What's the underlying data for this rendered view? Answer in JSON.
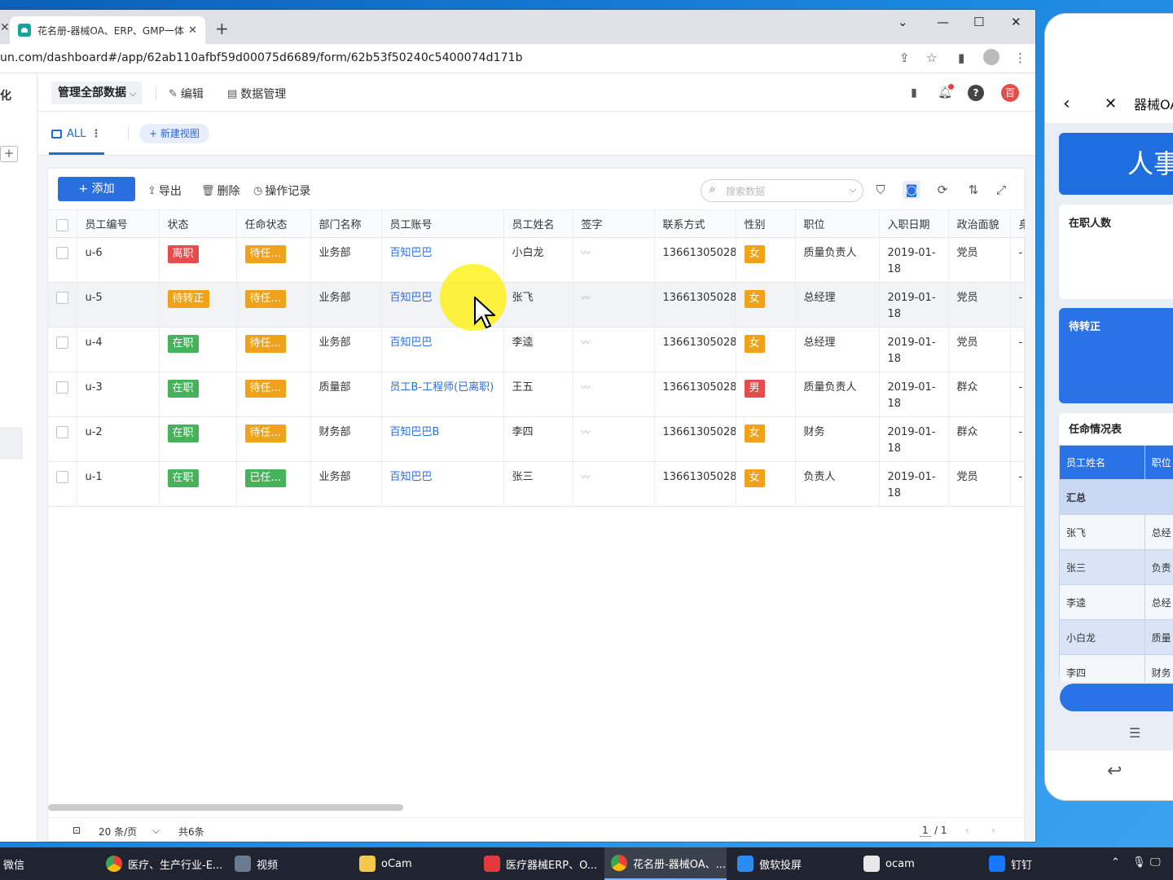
{
  "browser": {
    "tab_title": "花名册-器械OA、ERP、GMP一体化",
    "url": "un.com/dashboard#/app/62ab110afbf59d00075d6689/form/62b53f50240c5400074d171b"
  },
  "leftnav": {
    "brand": "化"
  },
  "topbar": {
    "scope": "管理全部数据",
    "edit": "编辑",
    "data_manage": "数据管理",
    "avatar": "百"
  },
  "viewbar": {
    "view_name": "ALL",
    "new_view": "新建视图"
  },
  "actions": {
    "add": "添加",
    "export": "导出",
    "delete": "删除",
    "history": "操作记录",
    "search_placeholder": "搜索数据"
  },
  "colors": {
    "green": "#46b35c",
    "orange": "#f0a21b",
    "red": "#e34d4d",
    "blue": "#2a6fe0"
  },
  "table": {
    "columns": [
      "员工编号",
      "状态",
      "任命状态",
      "部门名称",
      "员工账号",
      "员工姓名",
      "签字",
      "联系方式",
      "性别",
      "职位",
      "入职日期",
      "政治面貌",
      "身"
    ],
    "rows": [
      {
        "id": "u-6",
        "status": "离职",
        "status_color": "red",
        "appoint": "待任...",
        "appoint_color": "orange",
        "dept": "业务部",
        "account": "百知巴巴",
        "name": "小白龙",
        "sign": "[签名]",
        "phone": "13661305028",
        "gender": "女",
        "gender_color": "orange",
        "position": "质量负责人",
        "date": "2019-01-18",
        "political": "党员",
        "extra": "-"
      },
      {
        "id": "u-5",
        "status": "待转正",
        "status_color": "orange",
        "appoint": "待任...",
        "appoint_color": "orange",
        "dept": "业务部",
        "account": "百知巴巴",
        "name": "张飞",
        "sign": "[签名]",
        "phone": "13661305028",
        "gender": "女",
        "gender_color": "orange",
        "position": "总经理",
        "date": "2019-01-18",
        "political": "党员",
        "extra": "-"
      },
      {
        "id": "u-4",
        "status": "在职",
        "status_color": "green",
        "appoint": "待任...",
        "appoint_color": "orange",
        "dept": "业务部",
        "account": "百知巴巴",
        "name": "李逵",
        "sign": "[签名]",
        "phone": "13661305028",
        "gender": "女",
        "gender_color": "orange",
        "position": "总经理",
        "date": "2019-01-18",
        "political": "党员",
        "extra": "-"
      },
      {
        "id": "u-3",
        "status": "在职",
        "status_color": "green",
        "appoint": "待任...",
        "appoint_color": "orange",
        "dept": "质量部",
        "account": "员工B-工程师(已离职)",
        "name": "王五",
        "sign": "[签名]",
        "phone": "13661305028",
        "gender": "男",
        "gender_color": "red",
        "position": "质量负责人",
        "date": "2019-01-18",
        "political": "群众",
        "extra": "-"
      },
      {
        "id": "u-2",
        "status": "在职",
        "status_color": "green",
        "appoint": "待任...",
        "appoint_color": "orange",
        "dept": "财务部",
        "account": "百知巴巴B",
        "name": "李四",
        "sign": "[签名]",
        "phone": "13661305028",
        "gender": "女",
        "gender_color": "orange",
        "position": "财务",
        "date": "2019-01-18",
        "political": "群众",
        "extra": "-"
      },
      {
        "id": "u-1",
        "status": "在职",
        "status_color": "green",
        "appoint": "已任...",
        "appoint_color": "green",
        "dept": "业务部",
        "account": "百知巴巴",
        "name": "张三",
        "sign": "[签名]",
        "phone": "13661305028",
        "gender": "女",
        "gender_color": "orange",
        "position": "负责人",
        "date": "2019-01-18",
        "political": "党员",
        "extra": "-"
      }
    ],
    "highlighted_row": 1
  },
  "pager": {
    "page_size": "20 条/页",
    "total": "共6条",
    "current": "1",
    "pages": "/ 1"
  },
  "phone": {
    "title": "器械OA",
    "banner": "人事",
    "card_employees": "在职人数",
    "card_probation": "待转正",
    "appoint_title": "任命情况表",
    "table_head": [
      "员工姓名",
      "职位"
    ],
    "summary": "汇总",
    "rows": [
      [
        "张飞",
        "总经"
      ],
      [
        "张三",
        "负责"
      ],
      [
        "李逵",
        "总经"
      ],
      [
        "小白龙",
        "质量"
      ],
      [
        "李四",
        "财务"
      ]
    ]
  },
  "taskbar": {
    "items": [
      "微信",
      "医疗、生产行业-E...",
      "视频",
      "oCam",
      "医疗器械ERP、O...",
      "花名册-器械OA、...",
      "傲软投屏",
      "ocam",
      "钉钉"
    ]
  }
}
